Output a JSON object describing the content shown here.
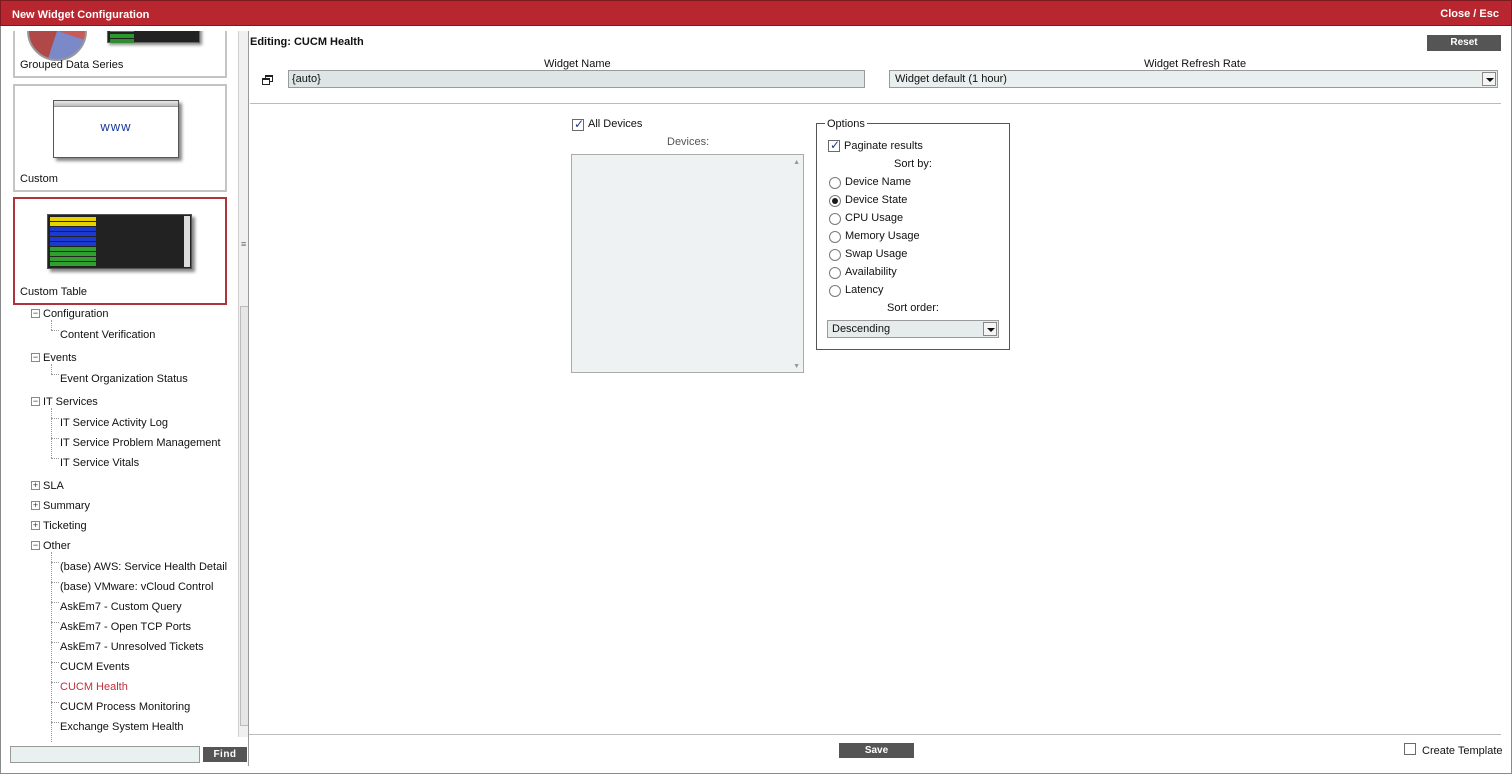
{
  "window": {
    "title": "New Widget Configuration",
    "close_label": "Close / Esc"
  },
  "tiles": [
    {
      "label": "Grouped Data Series"
    },
    {
      "label": "Custom",
      "thumb_text": "www"
    },
    {
      "label": "Custom Table"
    }
  ],
  "tree": {
    "configuration": {
      "label": "Configuration",
      "children": [
        "Content Verification"
      ]
    },
    "events": {
      "label": "Events",
      "children": [
        "Event Organization Status"
      ]
    },
    "it_services": {
      "label": "IT Services",
      "children": [
        "IT Service Activity Log",
        "IT Service Problem Management",
        "IT Service Vitals"
      ]
    },
    "sla": {
      "label": "SLA"
    },
    "summary": {
      "label": "Summary"
    },
    "ticketing": {
      "label": "Ticketing"
    },
    "other": {
      "label": "Other",
      "children": [
        "(base) AWS: Service Health Detail",
        "(base) VMware: vCloud Control",
        "AskEm7 - Custom Query",
        "AskEm7 - Open TCP Ports",
        "AskEm7 - Unresolved Tickets",
        "CUCM Events",
        "CUCM Health",
        "CUCM Process Monitoring",
        "Exchange System Health"
      ],
      "active_index": 6
    }
  },
  "find": {
    "value": "",
    "button_label": "Find"
  },
  "editor": {
    "heading": "Editing: CUCM Health",
    "reset_label": "Reset",
    "widget_name_label": "Widget Name",
    "widget_name_value": "{auto}",
    "refresh_rate_label": "Widget Refresh Rate",
    "refresh_rate_value": "Widget default (1 hour)",
    "all_devices_label": "All Devices",
    "all_devices_checked": true,
    "devices_label": "Devices:",
    "options": {
      "legend": "Options",
      "paginate_label": "Paginate results",
      "paginate_checked": true,
      "sort_by_label": "Sort by:",
      "sort_fields": [
        "Device Name",
        "Device State",
        "CPU Usage",
        "Memory Usage",
        "Swap Usage",
        "Availability",
        "Latency"
      ],
      "sort_selected": "Device State",
      "sort_order_label": "Sort order:",
      "sort_order_value": "Descending"
    },
    "save_label": "Save",
    "create_template_label": "Create Template",
    "create_template_checked": false
  },
  "colors": {
    "title_bar": "#b8262f",
    "active_item": "#c0313a",
    "selected_tile_border": "#b0333b",
    "button_bg": "#555555"
  }
}
